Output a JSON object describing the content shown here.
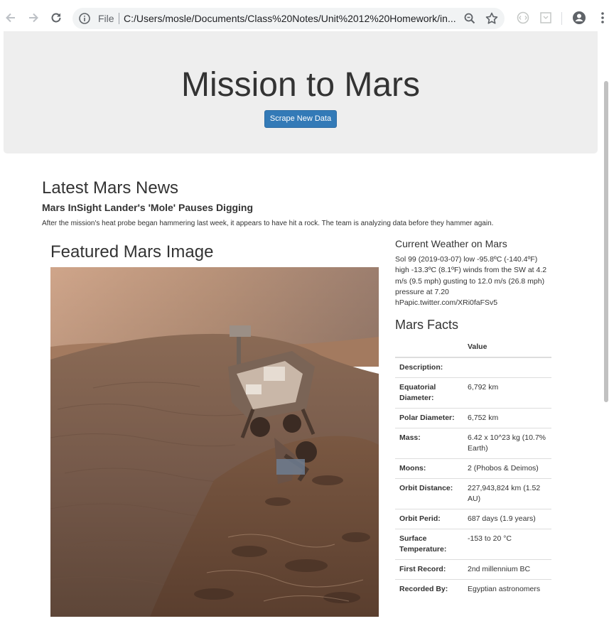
{
  "browser": {
    "file_label": "File",
    "url": "C:/Users/mosle/Documents/Class%20Notes/Unit%2012%20Homework/in..."
  },
  "header": {
    "title": "Mission to Mars",
    "scrape_button": "Scrape New Data"
  },
  "news": {
    "heading": "Latest Mars News",
    "title": "Mars InSight Lander's 'Mole' Pauses Digging",
    "paragraph": "After the mission's heat probe began hammering last week, it appears to have hit a rock. The team is analyzing data before they hammer again."
  },
  "featured": {
    "heading": "Featured Mars Image"
  },
  "weather": {
    "heading": "Current Weather on Mars",
    "text": "Sol 99 (2019-03-07) low -95.8ºC (-140.4ºF) high -13.3ºC (8.1ºF) winds from the SW at 4.2 m/s (9.5 mph) gusting to 12.0 m/s (26.8 mph) pressure at 7.20 hPapic.twitter.com/XRi0faFSv5"
  },
  "facts": {
    "heading": "Mars Facts",
    "value_header": "Value",
    "rows": [
      {
        "key": "Description:",
        "value": ""
      },
      {
        "key": "Equatorial Diameter:",
        "value": "6,792 km"
      },
      {
        "key": "Polar Diameter:",
        "value": "6,752 km"
      },
      {
        "key": "Mass:",
        "value": "6.42 x 10^23 kg (10.7% Earth)"
      },
      {
        "key": "Moons:",
        "value": "2 (Phobos & Deimos)"
      },
      {
        "key": "Orbit Distance:",
        "value": "227,943,824 km (1.52 AU)"
      },
      {
        "key": "Orbit Perid:",
        "value": "687 days (1.9 years)"
      },
      {
        "key": "Surface Temperature:",
        "value": "-153 to 20 °C"
      },
      {
        "key": "First Record:",
        "value": "2nd millennium BC"
      },
      {
        "key": "Recorded By:",
        "value": "Egyptian astronomers"
      }
    ]
  }
}
